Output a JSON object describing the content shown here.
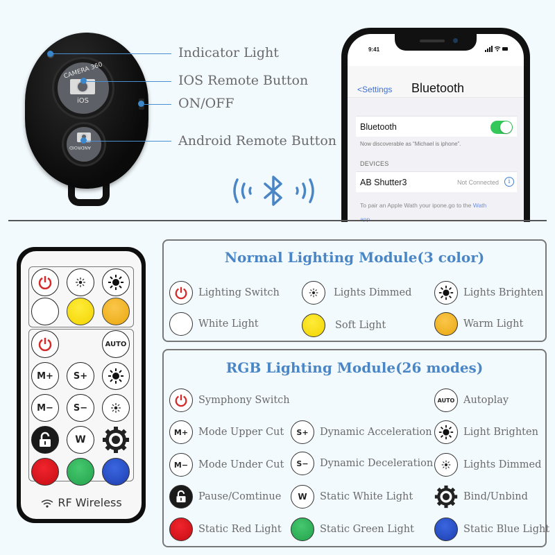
{
  "shutter_remote": {
    "ios_button_text_top": "CAMERA 360",
    "ios_button_text_bottom": "iOS",
    "android_button_text": "ANDROID",
    "callouts": [
      {
        "label": "Indicator Light"
      },
      {
        "label": "IOS Remote Button"
      },
      {
        "label": "ON/OFF"
      },
      {
        "label": "Android Remote Button"
      }
    ],
    "accent_color": "#3a87cc"
  },
  "bluetooth_symbol": {
    "icon": "bluetooth-icon",
    "color": "#4a86c5"
  },
  "phone": {
    "status_time": "9:41",
    "status_icons": "signal wifi battery",
    "nav_back_label": "Settings",
    "nav_title": "Bluetooth",
    "bluetooth_row_label": "Bluetooth",
    "bluetooth_enabled": true,
    "discoverable_note": "Now discoverable as “Michael is iphone”.",
    "devices_header": "DEVICES",
    "device_name": "AB Shutter3",
    "device_status": "Not Connected",
    "pair_note_prefix": "To pair an Apple Wath your ipone.go to the",
    "pair_note_link": "Wath",
    "pair_note_link2": "app.",
    "toggle_color": "#34c759",
    "link_color": "#3d6fd4"
  },
  "rf_remote": {
    "label": "RF Wireless",
    "buttons": {
      "auto": "AUTO",
      "m_plus": "M+",
      "s_plus": "S+",
      "m_minus": "M−",
      "s_minus": "S−",
      "w": "W"
    }
  },
  "normal_module": {
    "title": "Normal Lighting Module(3 color)",
    "items": [
      {
        "label": "Lighting Switch",
        "icon": "power-icon"
      },
      {
        "label": "Lights Dimmed",
        "icon": "dim-sun-icon"
      },
      {
        "label": "Lights Brighten",
        "icon": "bright-sun-icon"
      },
      {
        "label": "White Light",
        "icon": "white-swatch",
        "color": "#ffffff"
      },
      {
        "label": "Soft Light",
        "icon": "yellow-swatch",
        "color": "#f5dc0a"
      },
      {
        "label": "Warm Light",
        "icon": "amber-swatch",
        "color": "#f0b21a"
      }
    ]
  },
  "rgb_module": {
    "title": "RGB Lighting Module(26 modes)",
    "items": [
      {
        "label": "Symphony Switch",
        "icon": "power-icon"
      },
      {
        "label": "Autoplay",
        "icon": "auto-icon",
        "text": "AUTO"
      },
      {
        "label": "Mode Upper Cut",
        "icon": "m-plus-icon",
        "text": "M+"
      },
      {
        "label": "Dynamic Acceleration",
        "icon": "s-plus-icon",
        "text": "S+"
      },
      {
        "label": "Light Brighten",
        "icon": "bright-sun-icon"
      },
      {
        "label": "Mode Under Cut",
        "icon": "m-minus-icon",
        "text": "M−"
      },
      {
        "label": "Dynamic Deceleration",
        "icon": "s-minus-icon",
        "text": "S−"
      },
      {
        "label": "Lights Dimmed",
        "icon": "dim-sun-icon"
      },
      {
        "label": "Pause/Comtinue",
        "icon": "lock-icon"
      },
      {
        "label": "Static White Light",
        "icon": "w-icon",
        "text": "W"
      },
      {
        "label": "Bind/Unbind",
        "icon": "gear-icon"
      },
      {
        "label": "Static Red Light",
        "icon": "red-swatch",
        "color": "#d8121b"
      },
      {
        "label": "Static Green Light",
        "icon": "green-swatch",
        "color": "#2fb35a"
      },
      {
        "label": "Static Blue Light",
        "icon": "blue-swatch",
        "color": "#2750c8"
      }
    ]
  },
  "colors": {
    "title_blue": "#4a86c5",
    "power_red": "#d42a2a",
    "label_gray": "#6a6a6a"
  }
}
